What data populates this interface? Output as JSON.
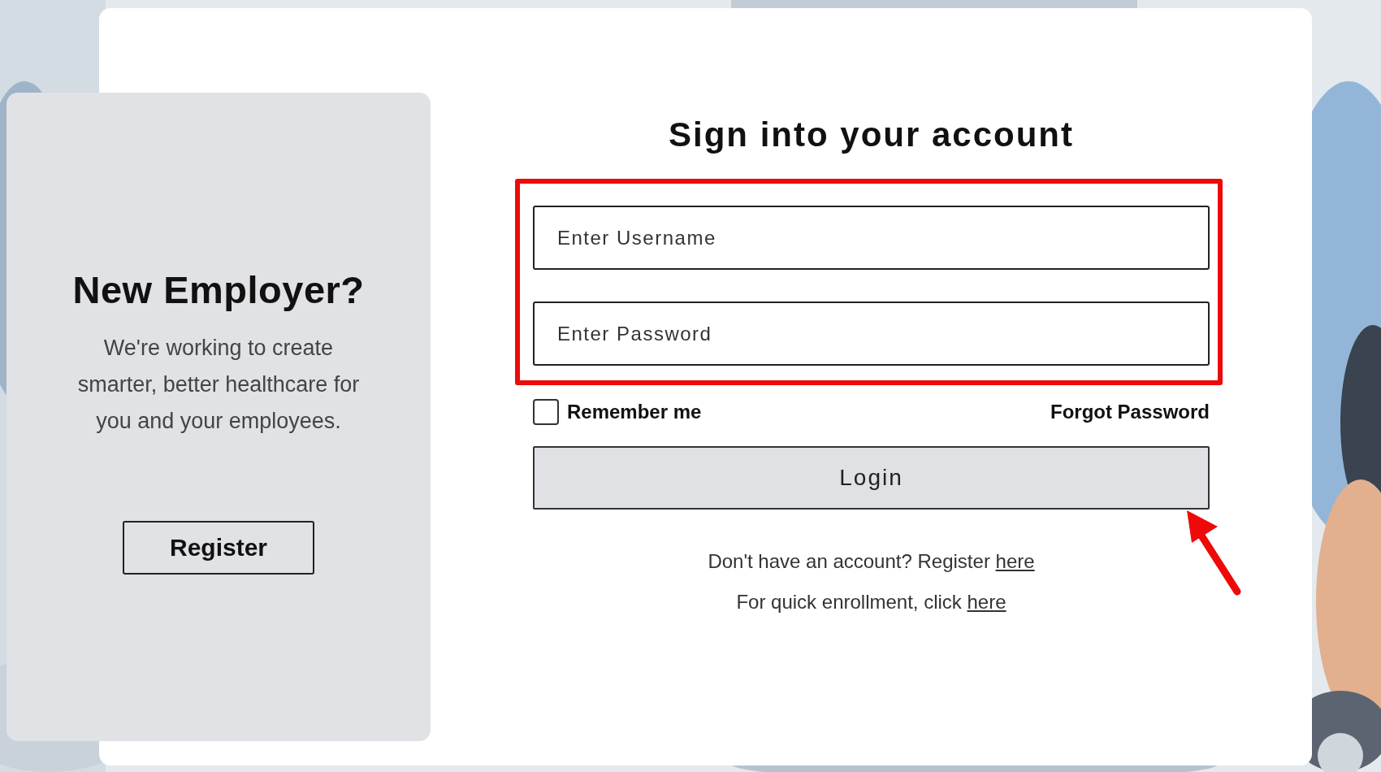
{
  "employer_panel": {
    "title": "New Employer?",
    "text": "We're working to create smarter, better healthcare for you and your employees.",
    "button": "Register"
  },
  "signin": {
    "title": "Sign into your account",
    "username": {
      "placeholder": "Enter Username"
    },
    "password": {
      "placeholder": "Enter Password"
    },
    "remember": {
      "label": "Remember me",
      "checked": false
    },
    "forgot": "Forgot Password",
    "login": "Login",
    "register_line": {
      "text": "Don't have an account? Register",
      "link": "here"
    },
    "enroll_line": {
      "text": "For quick enrollment, click",
      "link": "here"
    }
  }
}
